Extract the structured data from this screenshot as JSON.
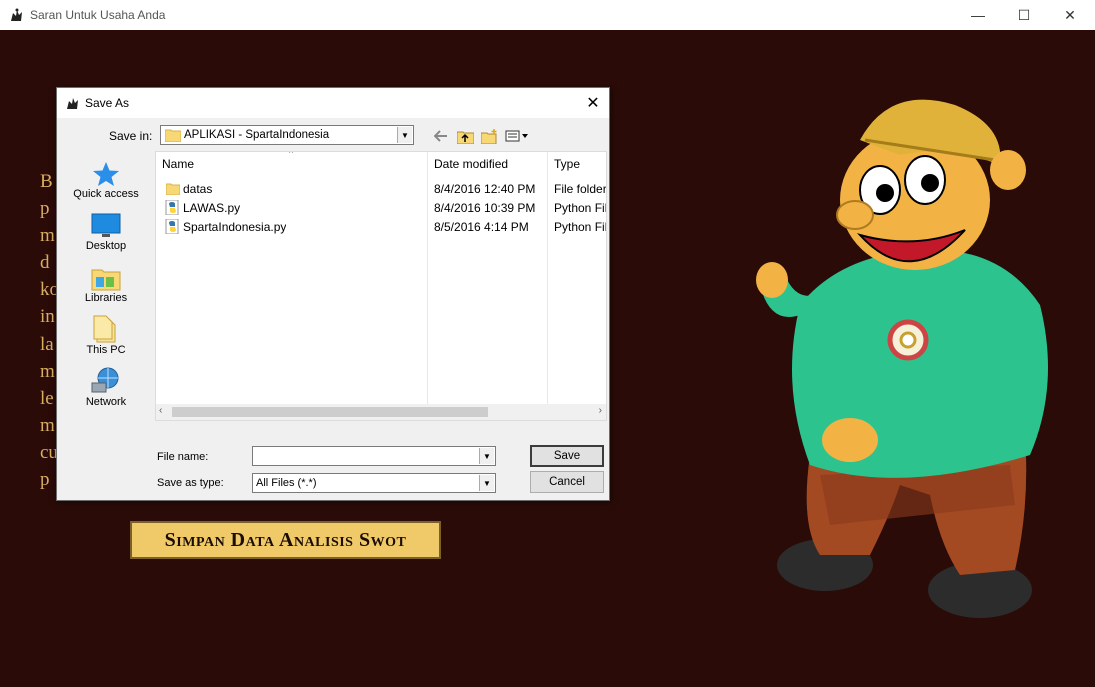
{
  "window": {
    "title": "Saran Untuk Usaha Anda",
    "minimize": "—",
    "maximize": "☐",
    "close": "✕"
  },
  "background": {
    "left_text_fragments": [
      "B",
      "p",
      "m",
      "d",
      "ko",
      "in",
      "la",
      "m",
      "le",
      "m",
      "cu",
      "p"
    ],
    "button_label": "Simpan Data Analisis Swot",
    "colors": {
      "bg": "#2a0b08",
      "text": "#d8ae62",
      "button": "#f0c968"
    }
  },
  "dialog": {
    "title": "Save As",
    "close": "✕",
    "save_in_label": "Save in:",
    "save_in_value": "APLIKASI - SpartaIndonesia",
    "places": [
      {
        "icon": "star-icon",
        "label": "Quick access"
      },
      {
        "icon": "desktop-icon",
        "label": "Desktop"
      },
      {
        "icon": "libraries-icon",
        "label": "Libraries"
      },
      {
        "icon": "this-pc-icon",
        "label": "This PC"
      },
      {
        "icon": "network-icon",
        "label": "Network"
      }
    ],
    "columns": {
      "name": "Name",
      "date": "Date modified",
      "type": "Type"
    },
    "files": [
      {
        "icon": "folder-icon",
        "name": "datas",
        "date": "8/4/2016 12:40 PM",
        "type": "File folder"
      },
      {
        "icon": "python-file-icon",
        "name": "LAWAS.py",
        "date": "8/4/2016 10:39 PM",
        "type": "Python Fil"
      },
      {
        "icon": "python-file-icon",
        "name": "SpartaIndonesia.py",
        "date": "8/5/2016 4:14 PM",
        "type": "Python Fil"
      }
    ],
    "file_name_label": "File name:",
    "file_name_value": "",
    "save_type_label": "Save as type:",
    "save_type_value": "All Files (*.*)",
    "save_button": "Save",
    "cancel_button": "Cancel"
  }
}
